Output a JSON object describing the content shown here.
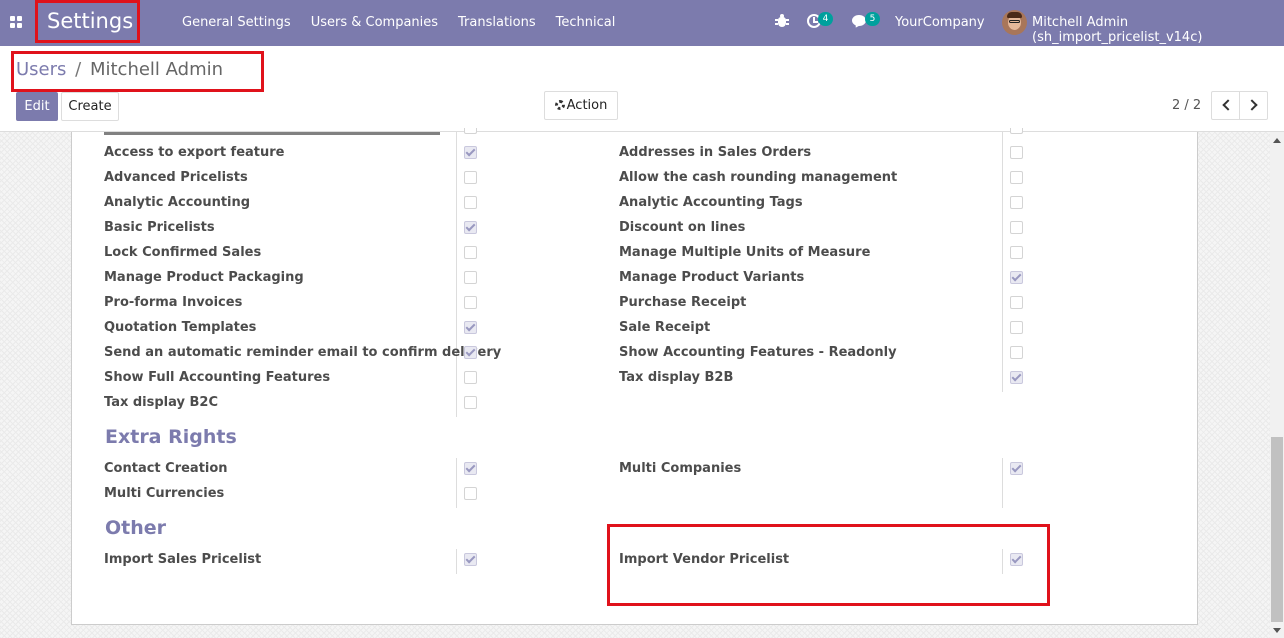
{
  "navbar": {
    "brand": "Settings",
    "menu": [
      "General Settings",
      "Users & Companies",
      "Translations",
      "Technical"
    ],
    "activity_count": "4",
    "message_count": "5",
    "company": "YourCompany",
    "user": "Mitchell Admin (sh_import_pricelist_v14c)"
  },
  "breadcrumb": {
    "parent": "Users",
    "separator": "/",
    "current": "Mitchell Admin"
  },
  "buttons": {
    "edit": "Edit",
    "create": "Create",
    "action": "Action"
  },
  "pager": {
    "value": "2 / 2"
  },
  "technical_settings": {
    "left": [
      {
        "label": "Access to export feature",
        "checked": true
      },
      {
        "label": "Advanced Pricelists",
        "checked": false
      },
      {
        "label": "Analytic Accounting",
        "checked": false
      },
      {
        "label": "Basic Pricelists",
        "checked": true
      },
      {
        "label": "Lock Confirmed Sales",
        "checked": false
      },
      {
        "label": "Manage Product Packaging",
        "checked": false
      },
      {
        "label": "Pro-forma Invoices",
        "checked": false
      },
      {
        "label": "Quotation Templates",
        "checked": true
      },
      {
        "label": "Send an automatic reminder email to confirm delivery",
        "checked": true
      },
      {
        "label": "Show Full Accounting Features",
        "checked": false
      },
      {
        "label": "Tax display B2C",
        "checked": false
      }
    ],
    "right": [
      {
        "label": "Addresses in Sales Orders",
        "checked": false
      },
      {
        "label": "Allow the cash rounding management",
        "checked": false
      },
      {
        "label": "Analytic Accounting Tags",
        "checked": false
      },
      {
        "label": "Discount on lines",
        "checked": false
      },
      {
        "label": "Manage Multiple Units of Measure",
        "checked": false
      },
      {
        "label": "Manage Product Variants",
        "checked": true
      },
      {
        "label": "Purchase Receipt",
        "checked": false
      },
      {
        "label": "Sale Receipt",
        "checked": false
      },
      {
        "label": "Show Accounting Features - Readonly",
        "checked": false
      },
      {
        "label": "Tax display B2B",
        "checked": true
      }
    ]
  },
  "extra_rights": {
    "title": "Extra Rights",
    "left": [
      {
        "label": "Contact Creation",
        "checked": true
      },
      {
        "label": "Multi Currencies",
        "checked": false
      }
    ],
    "right": [
      {
        "label": "Multi Companies",
        "checked": true
      }
    ]
  },
  "other": {
    "title": "Other",
    "left": [
      {
        "label": "Import Sales Pricelist",
        "checked": true
      }
    ],
    "right": [
      {
        "label": "Import Vendor Pricelist",
        "checked": true
      }
    ]
  },
  "colors": {
    "navbar": "#7c7bad",
    "highlight": "#e0121b",
    "accent": "#7c7bad"
  }
}
